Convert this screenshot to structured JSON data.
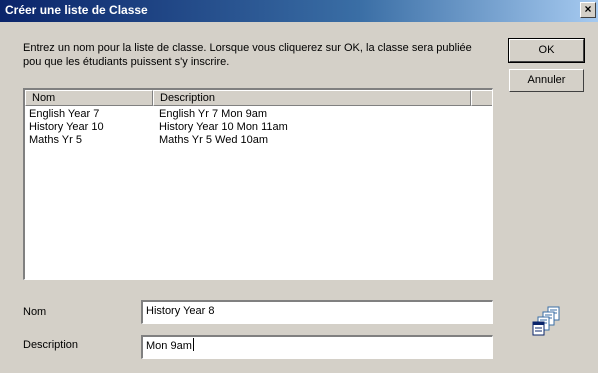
{
  "window": {
    "title": "Créer une liste de Classe",
    "close_label": "×"
  },
  "instructions": "Entrez un nom pour la liste de classe. Lorsque vous cliquerez sur OK, la classe sera publiée pou que les étudiants puissent s'y inscrire.",
  "buttons": {
    "ok_label": "OK",
    "cancel_label": "Annuler"
  },
  "class_list": {
    "columns": [
      "Nom",
      "Description"
    ],
    "rows": [
      {
        "name": "English Year 7",
        "description": "English Yr 7 Mon 9am"
      },
      {
        "name": "History Year 10",
        "description": "History Year 10 Mon 11am"
      },
      {
        "name": "Maths Yr 5",
        "description": "Maths Yr 5 Wed 10am"
      }
    ]
  },
  "form": {
    "name_label": "Nom",
    "name_value": "History Year 8",
    "description_label": "Description",
    "description_value": "Mon 9am"
  },
  "icons": {
    "decoration": "class-list-icon",
    "accent": "#0a246a"
  }
}
